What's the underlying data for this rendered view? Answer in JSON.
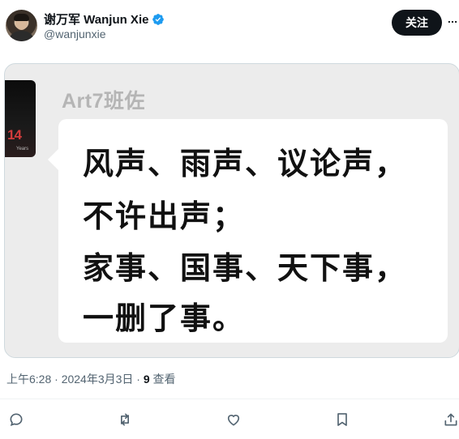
{
  "author": {
    "display_name": "谢万军 Wanjun Xie",
    "handle": "@wanjunxie",
    "follow_label": "关注"
  },
  "media": {
    "sender": "Art7班佐",
    "thumb_badge": "14",
    "thumb_caption": "Years",
    "message_lines": [
      "风声、雨声、议论声，",
      "不许出声；",
      "家事、国事、天下事，",
      "一删了事。"
    ]
  },
  "meta": {
    "time_date": "上午6:28 · 2024年3月3日 · ",
    "views_count": "9",
    "views_label": " 查看"
  },
  "icons": {
    "verified": "verified-badge-icon",
    "more": "more-icon",
    "reply": "reply-icon",
    "retweet": "retweet-icon",
    "like": "like-icon",
    "bookmark": "bookmark-icon",
    "share": "share-icon"
  },
  "colors": {
    "verified": "#1d9bf0",
    "text": "#0f1419",
    "secondary": "#536471"
  }
}
